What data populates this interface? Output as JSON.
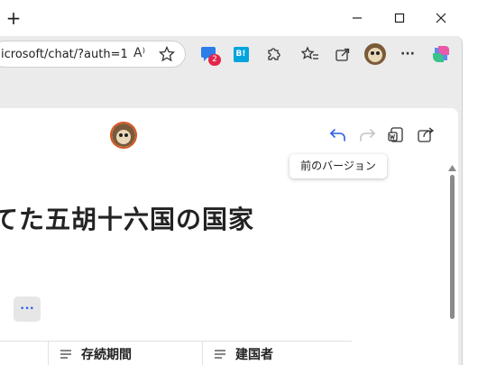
{
  "browser": {
    "new_tab_glyph": "+",
    "address_text": "icrosoft/chat/?auth=1",
    "read_aloud_glyph": "A⁾",
    "chat_badge": "2",
    "hatena_label": "B!",
    "more_glyph": "···"
  },
  "page": {
    "tooltip": "前のバージョン",
    "title": "てた五胡十六国の国家",
    "more_glyph": "•••",
    "table_headers": [
      "存続期間",
      "建国者"
    ]
  },
  "colors": {
    "accent_blue": "#2b5ce6",
    "badge_red": "#e3254a",
    "avatar_ring": "#d9541e"
  }
}
